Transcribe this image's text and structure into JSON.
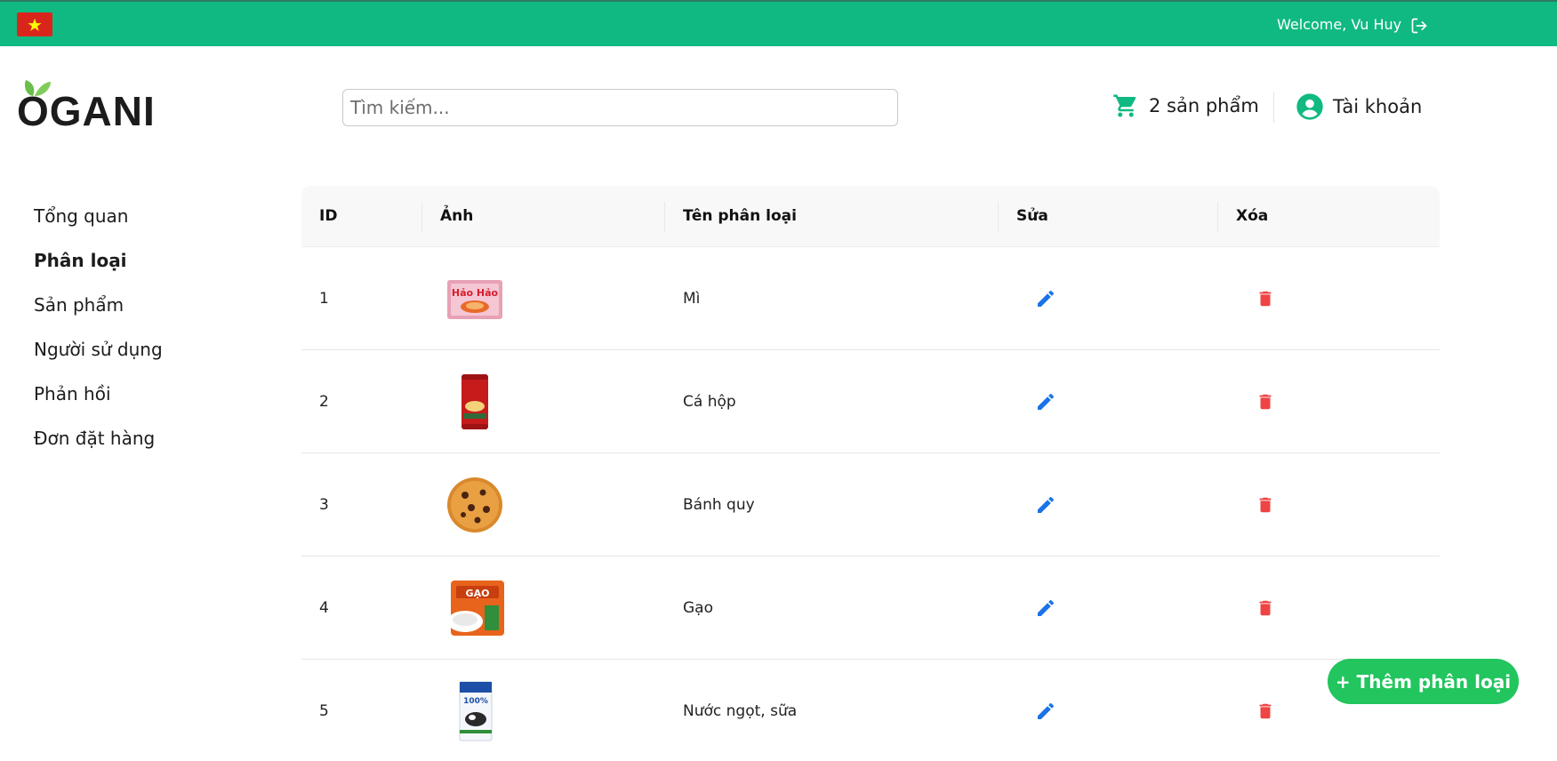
{
  "topbar": {
    "welcome_text": "Welcome, Vu Huy",
    "flag_icon": "vietnam-flag-icon",
    "logout_icon": "logout-icon",
    "background_color": "#10b981"
  },
  "header": {
    "logo_text": "OGANI",
    "search_placeholder": "Tìm kiếm...",
    "cart_label": "2 sản phẩm",
    "cart_icon": "cart-icon",
    "account_label": "Tài khoản",
    "account_icon": "user-circle-icon",
    "accent_color": "#10b981"
  },
  "sidebar": {
    "items": [
      {
        "label": "Tổng quan",
        "active": false
      },
      {
        "label": "Phân loại",
        "active": true
      },
      {
        "label": "Sản phẩm",
        "active": false
      },
      {
        "label": "Người sử dụng",
        "active": false
      },
      {
        "label": "Phản hồi",
        "active": false
      },
      {
        "label": "Đơn đặt hàng",
        "active": false
      }
    ]
  },
  "table": {
    "columns": [
      "ID",
      "Ảnh",
      "Tên phân loại",
      "Sửa",
      "Xóa"
    ],
    "rows": [
      {
        "id": "1",
        "image": "noodle-pack-image",
        "name": "Mì"
      },
      {
        "id": "2",
        "image": "canned-fish-image",
        "name": "Cá hộp"
      },
      {
        "id": "3",
        "image": "cookie-image",
        "name": "Bánh quy"
      },
      {
        "id": "4",
        "image": "rice-bag-image",
        "name": "Gạo"
      },
      {
        "id": "5",
        "image": "milk-carton-image",
        "name": "Nước ngọt, sữa"
      }
    ],
    "edit_icon": "pencil-icon",
    "delete_icon": "trash-icon",
    "edit_color": "#1a73e8",
    "delete_color": "#ef4444"
  },
  "actions": {
    "add_label": "+ Thêm phân loại",
    "add_color": "#22c55e"
  }
}
